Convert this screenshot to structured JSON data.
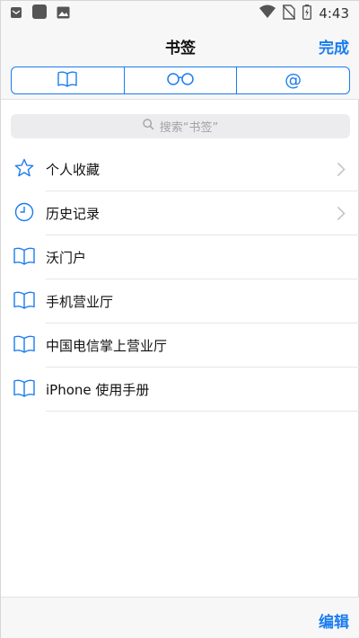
{
  "status_bar": {
    "time": "4:43",
    "icons_left": [
      "mail-notification-icon",
      "app-notification-icon",
      "image-notification-icon"
    ],
    "icons_right": [
      "wifi-icon",
      "no-sim-icon",
      "battery-charging-icon"
    ]
  },
  "nav": {
    "title": "书签",
    "done_label": "完成"
  },
  "segments": [
    {
      "icon": "bookmarks-book-icon",
      "selected": true
    },
    {
      "icon": "reading-list-glasses-icon",
      "selected": false
    },
    {
      "icon": "shared-links-at-icon",
      "label": "@",
      "selected": false
    }
  ],
  "search": {
    "placeholder": "搜索“书签”"
  },
  "bookmarks": [
    {
      "label": "个人收藏",
      "icon": "star-icon",
      "has_chevron": true
    },
    {
      "label": "历史记录",
      "icon": "clock-icon",
      "has_chevron": true
    },
    {
      "label": "沃门户",
      "icon": "book-icon",
      "has_chevron": false
    },
    {
      "label": "手机营业厅",
      "icon": "book-icon",
      "has_chevron": false
    },
    {
      "label": "中国电信掌上营业厅",
      "icon": "book-icon",
      "has_chevron": false
    },
    {
      "label": "iPhone 使用手册",
      "icon": "book-icon",
      "has_chevron": false
    }
  ],
  "bottom": {
    "edit_label": "编辑"
  },
  "colors": {
    "accent": "#1a7cf0",
    "bar_bg": "#f7f7f7",
    "search_bg": "#ececee",
    "separator": "#e6e6e6"
  }
}
